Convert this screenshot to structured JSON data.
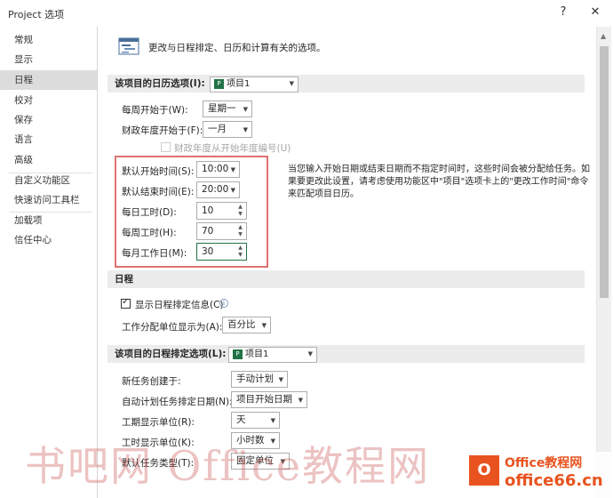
{
  "window": {
    "title": "Project 选项",
    "help": "?",
    "close": "✕"
  },
  "sidebar": {
    "items": [
      "常规",
      "显示",
      "日程",
      "校对",
      "保存",
      "语言",
      "高级",
      "自定义功能区",
      "快速访问工具栏",
      "加载项",
      "信任中心"
    ],
    "selected": "日程"
  },
  "header": {
    "text": "更改与日程排定、日历和计算有关的选项。"
  },
  "calendar_section": {
    "title": "该项目的日历选项(I):",
    "project": "项目1",
    "week_start_label": "每周开始于(W):",
    "week_start_value": "星期一",
    "fiscal_start_label": "财政年度开始于(F):",
    "fiscal_start_value": "一月",
    "fiscal_numbering_label": "财政年度从开始年度编号(U)",
    "default_start_label": "默认开始时间(S):",
    "default_start_value": "10:00",
    "default_end_label": "默认结束时间(E):",
    "default_end_value": "20:00",
    "hours_day_label": "每日工时(D):",
    "hours_day_value": "10",
    "hours_week_label": "每周工时(H):",
    "hours_week_value": "70",
    "days_month_label": "每月工作日(M):",
    "days_month_value": "30",
    "note": "当您输入开始日期或结束日期而不指定时间时，这些时间会被分配给任务。如果要更改此设置，请考虑使用功能区中\"项目\"选项卡上的\"更改工作时间\"命令来匹配项目日历。"
  },
  "schedule_section": {
    "title": "日程",
    "show_messages_label": "显示日程排定信息(C)",
    "show_messages_checked": true,
    "units_label": "工作分配单位显示为(A):",
    "units_value": "百分比"
  },
  "schedule_options_section": {
    "title": "该项目的日程排定选项(L):",
    "project": "项目1",
    "new_tasks_label": "新任务创建于:",
    "new_tasks_value": "手动计划",
    "auto_tasks_label": "自动计划任务排定日期(N):",
    "auto_tasks_value": "项目开始日期",
    "duration_label": "工期显示单位(R):",
    "duration_value": "天",
    "work_label": "工时显示单位(K):",
    "work_value": "小时数",
    "task_type_label": "默认任务类型(T):",
    "task_type_value": "固定单位"
  },
  "watermark": {
    "text": "书吧网 Office教程网",
    "logo_line1": "Office教程网",
    "logo_line2": "office66.cn",
    "logo_mark": "O"
  },
  "colors": {
    "accent": "#217346",
    "highlight_box": "#e07272",
    "selected_nav": "#dcdcdc"
  }
}
